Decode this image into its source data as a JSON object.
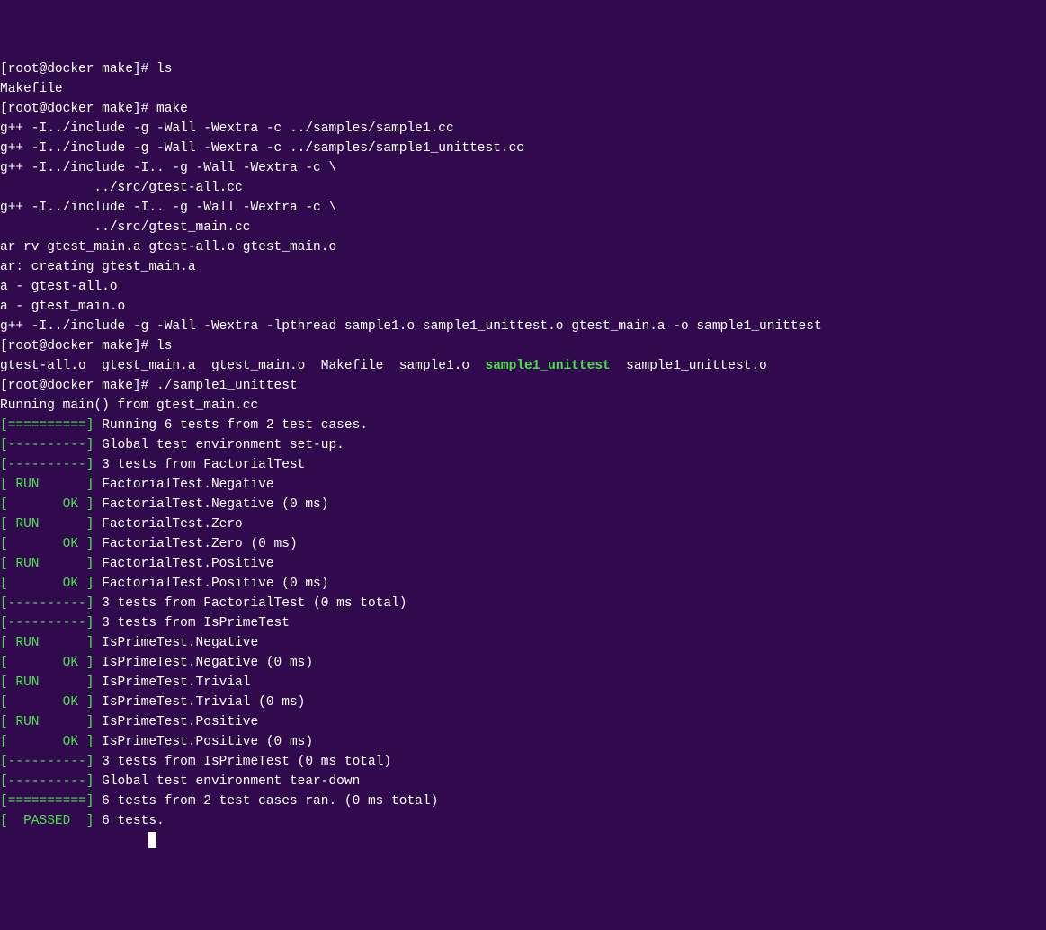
{
  "lines": [
    {
      "segments": [
        {
          "t": "[root@docker make]# ls"
        }
      ]
    },
    {
      "segments": [
        {
          "t": "Makefile"
        }
      ]
    },
    {
      "segments": [
        {
          "t": "[root@docker make]# make"
        }
      ]
    },
    {
      "segments": [
        {
          "t": "g++ -I../include -g -Wall -Wextra -c ../samples/sample1.cc"
        }
      ]
    },
    {
      "segments": [
        {
          "t": "g++ -I../include -g -Wall -Wextra -c ../samples/sample1_unittest.cc"
        }
      ]
    },
    {
      "segments": [
        {
          "t": "g++ -I../include -I.. -g -Wall -Wextra -c \\"
        }
      ]
    },
    {
      "segments": [
        {
          "t": "            ../src/gtest-all.cc"
        }
      ]
    },
    {
      "segments": [
        {
          "t": "g++ -I../include -I.. -g -Wall -Wextra -c \\"
        }
      ]
    },
    {
      "segments": [
        {
          "t": "            ../src/gtest_main.cc"
        }
      ]
    },
    {
      "segments": [
        {
          "t": "ar rv gtest_main.a gtest-all.o gtest_main.o"
        }
      ]
    },
    {
      "segments": [
        {
          "t": "ar: creating gtest_main.a"
        }
      ]
    },
    {
      "segments": [
        {
          "t": "a - gtest-all.o"
        }
      ]
    },
    {
      "segments": [
        {
          "t": "a - gtest_main.o"
        }
      ]
    },
    {
      "segments": [
        {
          "t": "g++ -I../include -g -Wall -Wextra -lpthread sample1.o sample1_unittest.o gtest_main.a -o sample1_unittest"
        }
      ]
    },
    {
      "segments": [
        {
          "t": "[root@docker make]# ls"
        }
      ]
    },
    {
      "segments": [
        {
          "t": "gtest-all.o  gtest_main.a  gtest_main.o  Makefile  sample1.o  "
        },
        {
          "t": "sample1_unittest",
          "c": "bold-green"
        },
        {
          "t": "  sample1_unittest.o"
        }
      ]
    },
    {
      "segments": [
        {
          "t": "[root@docker make]# ./sample1_unittest"
        }
      ]
    },
    {
      "segments": [
        {
          "t": "Running main() from gtest_main.cc"
        }
      ]
    },
    {
      "segments": [
        {
          "t": "[==========]",
          "c": "green"
        },
        {
          "t": " Running 6 tests from 2 test cases."
        }
      ]
    },
    {
      "segments": [
        {
          "t": "[----------]",
          "c": "green"
        },
        {
          "t": " Global test environment set-up."
        }
      ]
    },
    {
      "segments": [
        {
          "t": "[----------]",
          "c": "green"
        },
        {
          "t": " 3 tests from FactorialTest"
        }
      ]
    },
    {
      "segments": [
        {
          "t": "[ RUN      ]",
          "c": "green"
        },
        {
          "t": " FactorialTest.Negative"
        }
      ]
    },
    {
      "segments": [
        {
          "t": "[       OK ]",
          "c": "green"
        },
        {
          "t": " FactorialTest.Negative (0 ms)"
        }
      ]
    },
    {
      "segments": [
        {
          "t": "[ RUN      ]",
          "c": "green"
        },
        {
          "t": " FactorialTest.Zero"
        }
      ]
    },
    {
      "segments": [
        {
          "t": "[       OK ]",
          "c": "green"
        },
        {
          "t": " FactorialTest.Zero (0 ms)"
        }
      ]
    },
    {
      "segments": [
        {
          "t": "[ RUN      ]",
          "c": "green"
        },
        {
          "t": " FactorialTest.Positive"
        }
      ]
    },
    {
      "segments": [
        {
          "t": "[       OK ]",
          "c": "green"
        },
        {
          "t": " FactorialTest.Positive (0 ms)"
        }
      ]
    },
    {
      "segments": [
        {
          "t": "[----------]",
          "c": "green"
        },
        {
          "t": " 3 tests from FactorialTest (0 ms total)"
        }
      ]
    },
    {
      "segments": [
        {
          "t": ""
        }
      ]
    },
    {
      "segments": [
        {
          "t": "[----------]",
          "c": "green"
        },
        {
          "t": " 3 tests from IsPrimeTest"
        }
      ]
    },
    {
      "segments": [
        {
          "t": "[ RUN      ]",
          "c": "green"
        },
        {
          "t": " IsPrimeTest.Negative"
        }
      ]
    },
    {
      "segments": [
        {
          "t": "[       OK ]",
          "c": "green"
        },
        {
          "t": " IsPrimeTest.Negative (0 ms)"
        }
      ]
    },
    {
      "segments": [
        {
          "t": "[ RUN      ]",
          "c": "green"
        },
        {
          "t": " IsPrimeTest.Trivial"
        }
      ]
    },
    {
      "segments": [
        {
          "t": "[       OK ]",
          "c": "green"
        },
        {
          "t": " IsPrimeTest.Trivial (0 ms)"
        }
      ]
    },
    {
      "segments": [
        {
          "t": "[ RUN      ]",
          "c": "green"
        },
        {
          "t": " IsPrimeTest.Positive"
        }
      ]
    },
    {
      "segments": [
        {
          "t": "[       OK ]",
          "c": "green"
        },
        {
          "t": " IsPrimeTest.Positive (0 ms)"
        }
      ]
    },
    {
      "segments": [
        {
          "t": "[----------]",
          "c": "green"
        },
        {
          "t": " 3 tests from IsPrimeTest (0 ms total)"
        }
      ]
    },
    {
      "segments": [
        {
          "t": ""
        }
      ]
    },
    {
      "segments": [
        {
          "t": "[----------]",
          "c": "green"
        },
        {
          "t": " Global test environment tear-down"
        }
      ]
    },
    {
      "segments": [
        {
          "t": "[==========]",
          "c": "green"
        },
        {
          "t": " 6 tests from 2 test cases ran. (0 ms total)"
        }
      ]
    },
    {
      "segments": [
        {
          "t": "[  PASSED  ]",
          "c": "green"
        },
        {
          "t": " 6 tests."
        }
      ]
    }
  ],
  "cursor_prefix": "                   "
}
